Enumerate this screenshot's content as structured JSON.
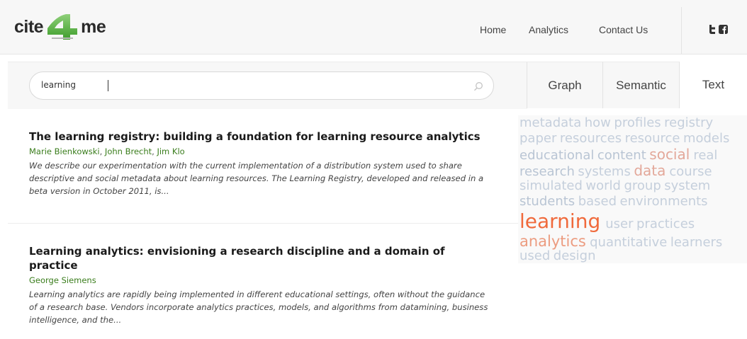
{
  "header": {
    "logo": {
      "left": "cite",
      "number": "4",
      "right": "me"
    },
    "nav": [
      {
        "label": "Home"
      },
      {
        "label": "Analytics"
      },
      {
        "label": "Contact Us"
      }
    ],
    "social": [
      {
        "icon": "twitter-icon"
      },
      {
        "icon": "facebook-icon"
      }
    ]
  },
  "search": {
    "value": "learning",
    "placeholder": "",
    "icon": "search-icon"
  },
  "tabs": [
    {
      "label": "Graph"
    },
    {
      "label": "Semantic"
    },
    {
      "label": "Text",
      "active": true
    }
  ],
  "results": [
    {
      "title": "The learning registry: building a foundation for learning resource analytics",
      "authors": [
        "Marie Bienkowski",
        "John Brecht",
        "Jim Klo"
      ],
      "abstract": "We describe our experimentation with the current implementation of a distribution system used to share descriptive and social metadata about learning resources. The Learning Registry, developed and released in a beta version in October 2011, is..."
    },
    {
      "title": "Learning analytics: envisioning a research discipline and a domain of practice",
      "authors": [
        "George Siemens"
      ],
      "abstract": "Learning analytics are rapidly being implemented in different educational settings, often without the guidance of a research base. Vendors incorporate analytics practices, models, and algorithms from datamining, business intelligence, and the..."
    }
  ],
  "word_cloud": {
    "lines": [
      [
        {
          "text": "metadata",
          "color": "#c5cfdc"
        },
        {
          "text": "how",
          "color": "#c5cfdc"
        },
        {
          "text": "profiles",
          "color": "#c5cfdc"
        },
        {
          "text": "registry",
          "color": "#c5cfdc"
        }
      ],
      [
        {
          "text": "paper",
          "color": "#c5cfdc"
        },
        {
          "text": "resources",
          "color": "#c5cfdc"
        },
        {
          "text": "resource",
          "color": "#c5cfdc"
        },
        {
          "text": "models",
          "color": "#c5cfdc"
        }
      ],
      [
        {
          "text": "educational",
          "color": "#b9c5d4"
        },
        {
          "text": "content",
          "color": "#b9c5d4"
        },
        {
          "text": "social",
          "color": "#e3a89a"
        },
        {
          "text": "real",
          "color": "#c5cfdc"
        }
      ],
      [
        {
          "text": "research",
          "color": "#b9c5d4"
        },
        {
          "text": "systems",
          "color": "#c5cfdc"
        },
        {
          "text": "data",
          "color": "#e3a89a"
        },
        {
          "text": "course",
          "color": "#c5cfdc"
        }
      ],
      [
        {
          "text": "simulated",
          "color": "#c5cfdc"
        },
        {
          "text": "world",
          "color": "#c5cfdc"
        },
        {
          "text": "group",
          "color": "#c5cfdc"
        },
        {
          "text": "system",
          "color": "#c5cfdc"
        }
      ],
      [
        {
          "text": "students",
          "color": "#b9c5d4"
        },
        {
          "text": "based",
          "color": "#c5cfdc"
        },
        {
          "text": "environments",
          "color": "#c5cfdc"
        }
      ],
      [
        {
          "text": "learning",
          "color": "#f06a3c"
        },
        {
          "text": "user",
          "color": "#c5cfdc"
        },
        {
          "text": "practices",
          "color": "#c5cfdc"
        }
      ],
      [
        {
          "text": "analytics",
          "color": "#ec9c80"
        },
        {
          "text": "quantitative",
          "color": "#c5cfdc"
        },
        {
          "text": "learners",
          "color": "#c5cfdc"
        }
      ],
      [
        {
          "text": "used",
          "color": "#c5cfdc"
        },
        {
          "text": "design",
          "color": "#c5cfdc"
        }
      ]
    ]
  },
  "colors": {
    "accent_green": "#4caf3a",
    "author_green": "#3a7d1c",
    "highlight_orange": "#f06a3c"
  }
}
